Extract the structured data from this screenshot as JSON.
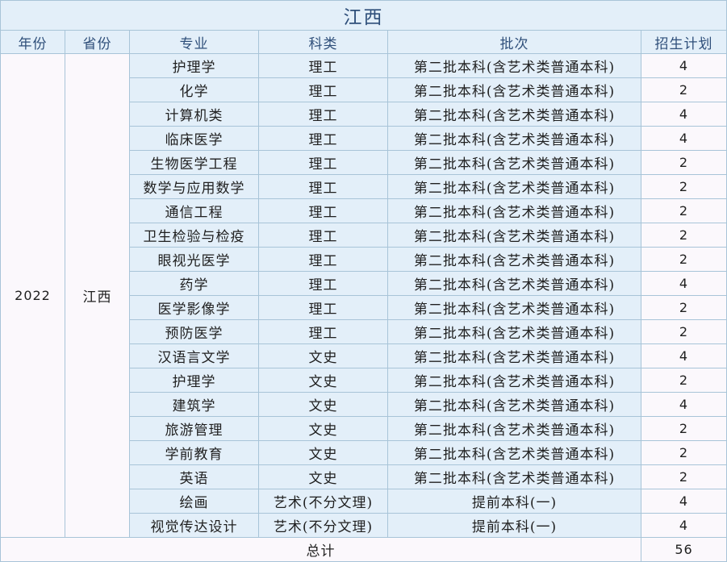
{
  "title": "江西",
  "headers": {
    "year": "年份",
    "province": "省份",
    "major": "专业",
    "category": "科类",
    "batch": "批次",
    "plan": "招生计划"
  },
  "year": "2022",
  "province": "江西",
  "rows": [
    {
      "major": "护理学",
      "category": "理工",
      "batch": "第二批本科(含艺术类普通本科)",
      "plan": "4"
    },
    {
      "major": "化学",
      "category": "理工",
      "batch": "第二批本科(含艺术类普通本科)",
      "plan": "2"
    },
    {
      "major": "计算机类",
      "category": "理工",
      "batch": "第二批本科(含艺术类普通本科)",
      "plan": "4"
    },
    {
      "major": "临床医学",
      "category": "理工",
      "batch": "第二批本科(含艺术类普通本科)",
      "plan": "4"
    },
    {
      "major": "生物医学工程",
      "category": "理工",
      "batch": "第二批本科(含艺术类普通本科)",
      "plan": "2"
    },
    {
      "major": "数学与应用数学",
      "category": "理工",
      "batch": "第二批本科(含艺术类普通本科)",
      "plan": "2"
    },
    {
      "major": "通信工程",
      "category": "理工",
      "batch": "第二批本科(含艺术类普通本科)",
      "plan": "2"
    },
    {
      "major": "卫生检验与检疫",
      "category": "理工",
      "batch": "第二批本科(含艺术类普通本科)",
      "plan": "2"
    },
    {
      "major": "眼视光医学",
      "category": "理工",
      "batch": "第二批本科(含艺术类普通本科)",
      "plan": "2"
    },
    {
      "major": "药学",
      "category": "理工",
      "batch": "第二批本科(含艺术类普通本科)",
      "plan": "4"
    },
    {
      "major": "医学影像学",
      "category": "理工",
      "batch": "第二批本科(含艺术类普通本科)",
      "plan": "2"
    },
    {
      "major": "预防医学",
      "category": "理工",
      "batch": "第二批本科(含艺术类普通本科)",
      "plan": "2"
    },
    {
      "major": "汉语言文学",
      "category": "文史",
      "batch": "第二批本科(含艺术类普通本科)",
      "plan": "4"
    },
    {
      "major": "护理学",
      "category": "文史",
      "batch": "第二批本科(含艺术类普通本科)",
      "plan": "2"
    },
    {
      "major": "建筑学",
      "category": "文史",
      "batch": "第二批本科(含艺术类普通本科)",
      "plan": "4"
    },
    {
      "major": "旅游管理",
      "category": "文史",
      "batch": "第二批本科(含艺术类普通本科)",
      "plan": "2"
    },
    {
      "major": "学前教育",
      "category": "文史",
      "batch": "第二批本科(含艺术类普通本科)",
      "plan": "2"
    },
    {
      "major": "英语",
      "category": "文史",
      "batch": "第二批本科(含艺术类普通本科)",
      "plan": "2"
    },
    {
      "major": "绘画",
      "category": "艺术(不分文理)",
      "batch": "提前本科(一)",
      "plan": "4"
    },
    {
      "major": "视觉传达设计",
      "category": "艺术(不分文理)",
      "batch": "提前本科(一)",
      "plan": "4"
    }
  ],
  "total": {
    "label": "总计",
    "value": "56"
  }
}
